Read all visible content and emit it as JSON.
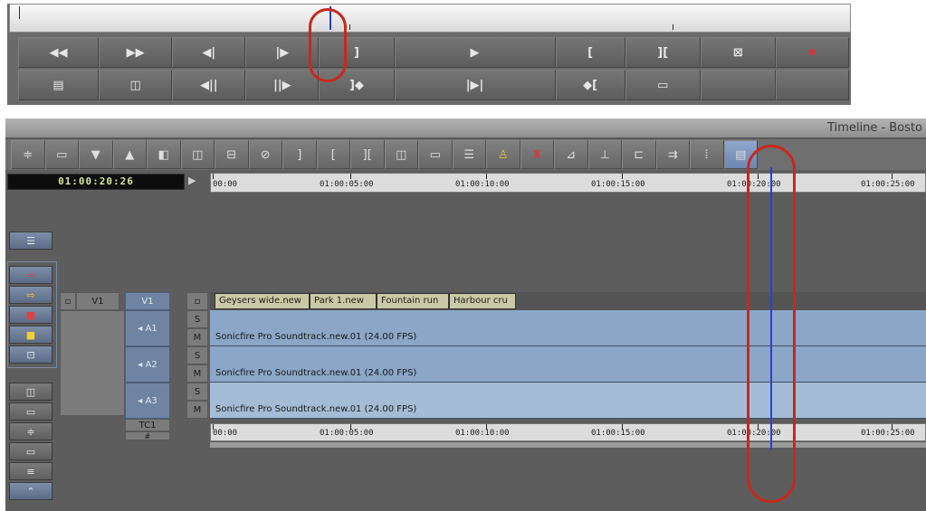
{
  "top_panel": {
    "row1": [
      {
        "name": "rewind-button",
        "icon": "rewind-icon",
        "glyph": "◀◀",
        "width": 90
      },
      {
        "name": "fast-forward-button",
        "icon": "fast-forward-icon",
        "glyph": "▶▶",
        "width": 82
      },
      {
        "name": "step-back-button",
        "icon": "step-back-icon",
        "glyph": "◀|",
        "width": 82
      },
      {
        "name": "step-forward-button",
        "icon": "step-forward-icon",
        "glyph": "|▶",
        "width": 82
      },
      {
        "name": "mark-out-button",
        "icon": "mark-out-icon",
        "glyph": "]",
        "width": 84
      },
      {
        "name": "play-button",
        "icon": "play-icon",
        "glyph": "▶",
        "width": 180
      },
      {
        "name": "mark-in-button",
        "icon": "mark-in-icon",
        "glyph": "[",
        "width": 78
      },
      {
        "name": "mark-clip-button",
        "icon": "mark-clip-icon",
        "glyph": "][",
        "width": 84
      },
      {
        "name": "clear-marks-button",
        "icon": "clear-marks-icon",
        "glyph": "⊠",
        "width": 84
      },
      {
        "name": "record-button",
        "icon": "record-icon",
        "glyph": "●",
        "width": 82
      }
    ],
    "row2": [
      {
        "name": "toggle-source-record-button",
        "icon": "source-record-icon",
        "glyph": "▤",
        "width": 90
      },
      {
        "name": "play-loop-button",
        "icon": "loop-icon",
        "glyph": "◫",
        "width": 82
      },
      {
        "name": "go-to-prev-edit-button",
        "icon": "prev-edit-icon",
        "glyph": "◀||",
        "width": 82
      },
      {
        "name": "go-to-next-edit-button",
        "icon": "next-edit-icon",
        "glyph": "||▶",
        "width": 82
      },
      {
        "name": "go-to-out-button",
        "icon": "go-to-out-icon",
        "glyph": "]◆",
        "width": 84
      },
      {
        "name": "play-in-to-out-button",
        "icon": "play-in-out-icon",
        "glyph": "|▶|",
        "width": 180
      },
      {
        "name": "go-to-in-button",
        "icon": "go-to-in-icon",
        "glyph": "◆[",
        "width": 78
      },
      {
        "name": "find-frame-button",
        "icon": "find-frame-icon",
        "glyph": "▭",
        "width": 84
      },
      {
        "name": "blank-button-1",
        "icon": "",
        "glyph": "",
        "width": 84
      },
      {
        "name": "blank-button-2",
        "icon": "",
        "glyph": "",
        "width": 82
      }
    ]
  },
  "timeline": {
    "title": "Timeline - Bosto",
    "toolbar": [
      {
        "name": "tool-settings-button",
        "icon": "sliders-icon",
        "glyph": "≑"
      },
      {
        "name": "tool-bin-button",
        "icon": "bin-icon",
        "glyph": "▭"
      },
      {
        "name": "tool-splice-button",
        "icon": "splice-in-icon",
        "glyph": "▼"
      },
      {
        "name": "tool-overwrite-button",
        "icon": "overwrite-icon",
        "glyph": "▲"
      },
      {
        "name": "tool-video-quality-button",
        "icon": "video-quality-icon",
        "glyph": "◧"
      },
      {
        "name": "tool-lift-button",
        "icon": "lift-icon",
        "glyph": "◫"
      },
      {
        "name": "tool-extract-button",
        "icon": "extract-icon",
        "glyph": "⊟"
      },
      {
        "name": "tool-match-frame-button",
        "icon": "match-frame-icon",
        "glyph": "⊘"
      },
      {
        "name": "tool-mark-out-button",
        "icon": "mark-out-icon",
        "glyph": "]"
      },
      {
        "name": "tool-mark-in-button",
        "icon": "mark-in-icon",
        "glyph": "["
      },
      {
        "name": "tool-mark-clip-button",
        "icon": "mark-clip-icon",
        "glyph": "]["
      },
      {
        "name": "tool-clear-marks-button",
        "icon": "clear-marks-icon",
        "glyph": "◫"
      },
      {
        "name": "tool-segment-button",
        "icon": "segment-icon",
        "glyph": "▭"
      },
      {
        "name": "tool-sync-button",
        "icon": "sync-icon",
        "glyph": "☰"
      },
      {
        "name": "tool-lift-overwrite-button",
        "icon": "lift-overwrite-icon",
        "glyph": "♙"
      },
      {
        "name": "tool-extract-splice-button",
        "icon": "extract-splice-icon",
        "glyph": "♜"
      },
      {
        "name": "tool-trim-a-button",
        "icon": "trim-icon",
        "glyph": "⊿"
      },
      {
        "name": "tool-trim-b-button",
        "icon": "trim-b-icon",
        "glyph": "⊥"
      },
      {
        "name": "tool-trim-c-button",
        "icon": "trim-c-icon",
        "glyph": "⊏"
      },
      {
        "name": "tool-add-edit-button",
        "icon": "add-edit-icon",
        "glyph": "⇉"
      },
      {
        "name": "tool-focus-button",
        "icon": "focus-icon",
        "glyph": "ⵂ"
      },
      {
        "name": "tool-toggle-active-button",
        "icon": "timeline-view-icon",
        "glyph": "▤"
      }
    ],
    "timecode": "01:00:20:26",
    "ruler_labels": [
      "00:00",
      "01:00:05:00",
      "01:00:10:00",
      "01:00:15:00",
      "01:00:20:00",
      "01:00:25:00"
    ],
    "tracks": {
      "v1_monitor": "V1",
      "v1_record": "V1",
      "a1": "A1",
      "a2": "A2",
      "a3": "A3",
      "tc1": "TC1",
      "s_label": "S",
      "m_label": "M",
      "hash": "#"
    },
    "video_clips": [
      "Geysers wide.new",
      "Park 1.new",
      "Fountain run",
      "Harbour cru"
    ],
    "audio_clip_label": "Sonicfire Pro Soundtrack.new.01 (24.00 FPS)"
  },
  "colors": {
    "position_indicator": "#2a3fd8",
    "annotation": "#c8281e",
    "audio_track": "#8ba6c7"
  }
}
